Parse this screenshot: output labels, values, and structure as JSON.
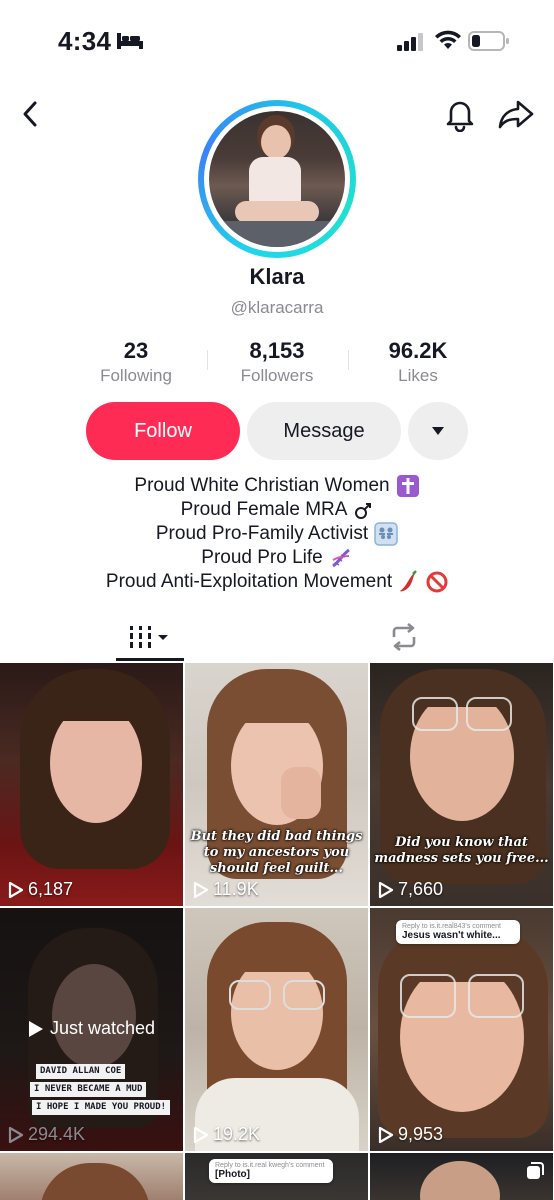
{
  "status_bar": {
    "time": "4:34"
  },
  "profile": {
    "display_name": "Klara",
    "handle": "@klaracarra",
    "stats": [
      {
        "value": "23",
        "label": "Following"
      },
      {
        "value": "8,153",
        "label": "Followers"
      },
      {
        "value": "96.2K",
        "label": "Likes"
      }
    ]
  },
  "actions": {
    "follow": "Follow",
    "message": "Message"
  },
  "bio": [
    {
      "text": "Proud White Christian Women",
      "emoji": "latin-cross",
      "color": "#9b59d0"
    },
    {
      "text": "Proud Female MRA",
      "emoji": "male-sign",
      "color": "#161823"
    },
    {
      "text": "Proud Pro-Family Activist",
      "emoji": "family",
      "color": "#8fb3d8"
    },
    {
      "text": "Proud Pro Life",
      "emoji": "dna",
      "color": "#7a5cd6"
    },
    {
      "text": "Proud Anti-Exploitation Movement",
      "emoji": "chili-no-entry",
      "color": "#d32f2f"
    }
  ],
  "videos": [
    {
      "views": "6,187",
      "caption": ""
    },
    {
      "views": "11.9K",
      "caption": "But they did bad things to my ancestors you should feel guilt..."
    },
    {
      "views": "7,660",
      "caption": "Did you know that madness sets you free..."
    },
    {
      "views": "294.4K",
      "caption": "",
      "overlay": "Just watched",
      "sticker_lines": [
        "DAVID ALLAN COE",
        "I NEVER BECAME A MUD",
        "I HOPE I MADE YOU PROUD!"
      ]
    },
    {
      "views": "19.2K",
      "caption": ""
    },
    {
      "views": "9,953",
      "caption": "",
      "comment_reply": "Reply to is.it.real843's comment",
      "comment_text": "Jesus wasn't white..."
    },
    {
      "views": "",
      "caption": ""
    },
    {
      "views": "",
      "caption": "",
      "comment_reply": "Reply to is.it.real kwegh's comment",
      "comment_text": "[Photo]"
    },
    {
      "views": "",
      "caption": ""
    }
  ]
}
